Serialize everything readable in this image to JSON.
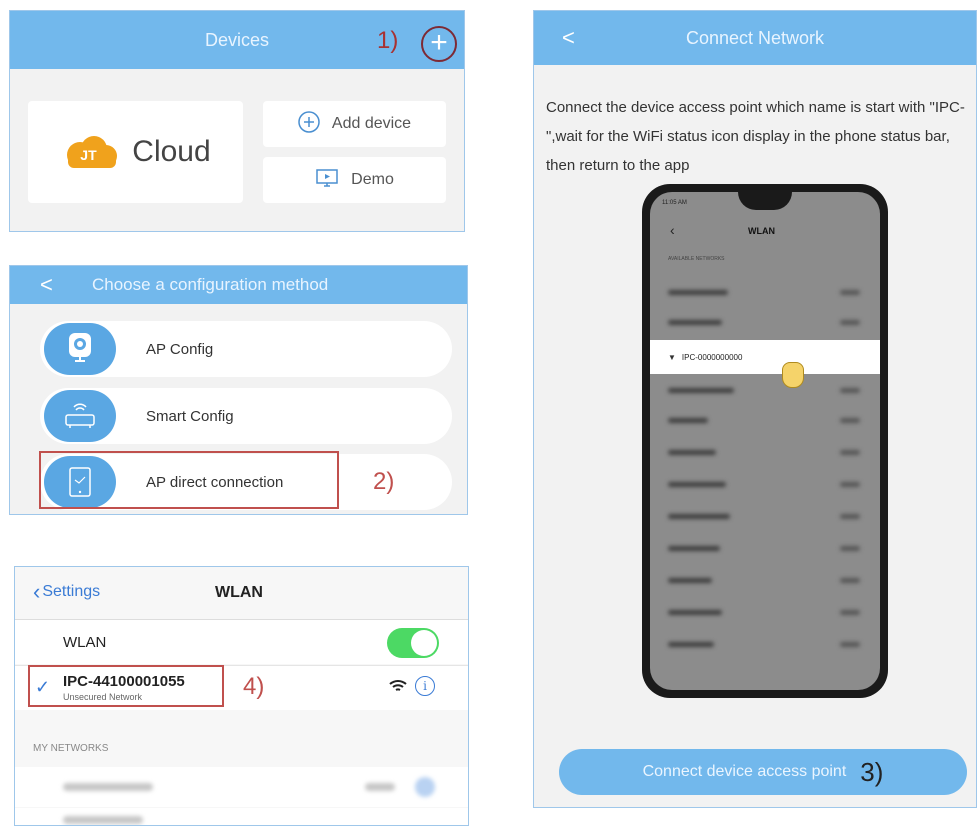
{
  "devices_panel": {
    "title": "Devices",
    "step_label": "1)",
    "plus_symbol": "+",
    "cloud_label": "Cloud",
    "cloud_icon_text": "JT",
    "add_device_label": "Add device",
    "demo_label": "Demo"
  },
  "config_panel": {
    "title": "Choose a configuration method",
    "back_symbol": "<",
    "items": [
      {
        "label": "AP Config"
      },
      {
        "label": "Smart Config"
      },
      {
        "label": "AP direct connection"
      }
    ],
    "step_label": "2)"
  },
  "wlan_panel": {
    "back_label": "Settings",
    "title": "WLAN",
    "wlan_label": "WLAN",
    "network_name": "IPC-44100001055",
    "network_sub": "Unsecured Network",
    "step_label": "4)",
    "my_networks_label": "MY NETWORKS"
  },
  "connect_panel": {
    "title": "Connect Network",
    "back_symbol": "<",
    "instruction": "Connect the device access point which name is start with \"IPC-\",wait for the WiFi status icon display in the phone status bar, then return to the app",
    "phone": {
      "status_time": "11:05 AM",
      "title": "WLAN",
      "section_label": "AVAILABLE NETWORKS",
      "highlight_network": "IPC-0000000000"
    },
    "button_label": "Connect device access point",
    "step_label": "3)"
  },
  "colors": {
    "header_blue": "#72b8ec",
    "accent_red": "#c0504d",
    "toggle_green": "#4cd964"
  }
}
